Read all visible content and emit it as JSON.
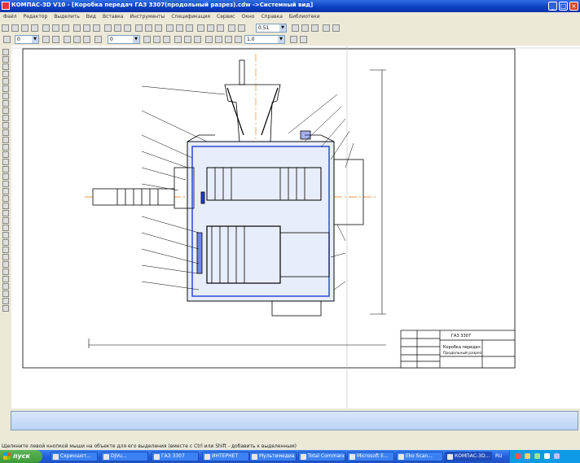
{
  "window": {
    "title": "КОМПАС-3D V10 - [Коробка передач ГАЗ 3307(продольный разрез).cdw ->Системный вид]",
    "controls": {
      "minimize": "_",
      "maximize": "□",
      "close": "×"
    }
  },
  "menu": [
    "Файл",
    "Редактор",
    "Выделить",
    "Вид",
    "Вставка",
    "Инструменты",
    "Спецификация",
    "Сервис",
    "Окно",
    "Справка",
    "Библиотеки"
  ],
  "toolbar": {
    "line_style_value": "0",
    "layer_value": "0",
    "scale_value": "1.0",
    "zoom_value": "0.51"
  },
  "drawing": {
    "title_block": {
      "doc_name": "Коробка передач",
      "subtitle": "Продольный разрез",
      "code": "ГАЗ 3307"
    }
  },
  "statusbar": {
    "hint": "Щелкните левой кнопкой мыши на объекте для его выделения (вместе с Ctrl или Shift - добавить к выделенным)"
  },
  "taskbar": {
    "start_label": "пуск",
    "tasks": [
      "Скриншот...",
      "DjVu...",
      "ГАЗ 3307",
      "ИНТЕРНЕТ",
      "Мультимедиа",
      "Total Commander",
      "Microsoft E...",
      "Eko Scan...",
      "КОМПАС-3D..."
    ],
    "lang": "RU"
  },
  "colors": {
    "title_blue": "#0a3fc2",
    "taskbar_blue": "#245edb",
    "start_green": "#3c9a3a"
  }
}
